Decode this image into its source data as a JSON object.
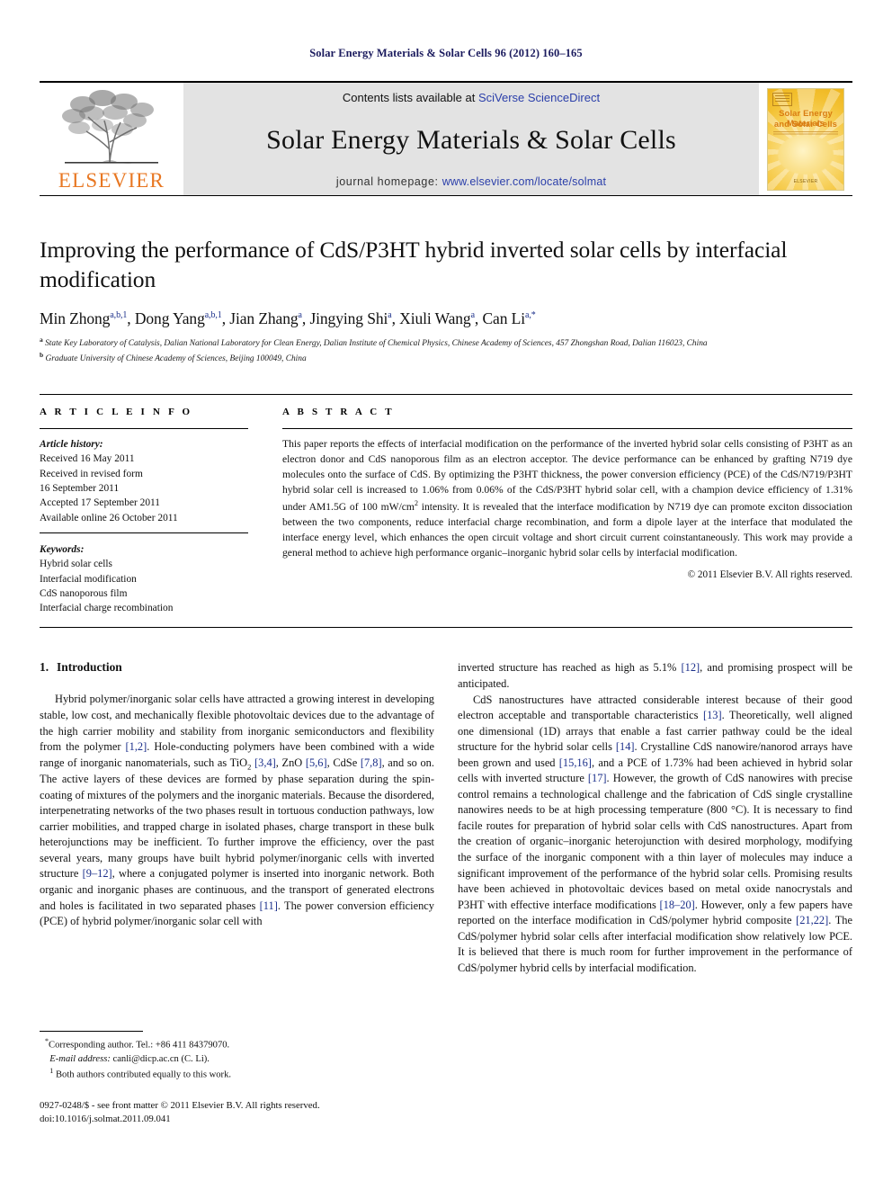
{
  "running_head": "Solar Energy Materials & Solar Cells 96 (2012) 160–165",
  "masthead": {
    "contents_prefix": "Contents lists available at ",
    "contents_link": "SciVerse ScienceDirect",
    "journal_title": "Solar Energy Materials & Solar Cells",
    "homepage_prefix": "journal homepage: ",
    "homepage_link": "www.elsevier.com/locate/solmat",
    "publisher_logo_text": "ELSEVIER",
    "publisher_logo_icon": "elsevier-tree-icon",
    "cover": {
      "title_line1": "Solar Energy Materials",
      "title_line2": "and Solar Cells",
      "footer_text": "ELSEVIER",
      "accent_color": "#E8A31B"
    },
    "link_color": "#2b3faa"
  },
  "article": {
    "title": "Improving the performance of CdS/P3HT hybrid inverted solar cells by interfacial modification",
    "authors": [
      {
        "name": "Min Zhong",
        "sup": "a,b,1",
        "sep": ", "
      },
      {
        "name": "Dong Yang",
        "sup": "a,b,1",
        "sep": ", "
      },
      {
        "name": "Jian Zhang",
        "sup": "a",
        "sep": ", "
      },
      {
        "name": "Jingying Shi",
        "sup": "a",
        "sep": ", "
      },
      {
        "name": "Xiuli Wang",
        "sup": "a",
        "sep": ", "
      },
      {
        "name": "Can Li",
        "sup": "a,*",
        "sep": ""
      }
    ],
    "affiliations": [
      {
        "marker": "a",
        "text": "State Key Laboratory of Catalysis, Dalian National Laboratory for Clean Energy, Dalian Institute of Chemical Physics, Chinese Academy of Sciences, 457 Zhongshan Road, Dalian 116023, China"
      },
      {
        "marker": "b",
        "text": "Graduate University of Chinese Academy of Sciences, Beijing 100049, China"
      }
    ]
  },
  "article_info": {
    "heading": "A R T I C L E   I N F O",
    "history_label": "Article history:",
    "history": [
      "Received 16 May 2011",
      "Received in revised form",
      "16 September 2011",
      "Accepted 17 September 2011",
      "Available online 26 October 2011"
    ],
    "keywords_label": "Keywords:",
    "keywords": [
      "Hybrid solar cells",
      "Interfacial modification",
      "CdS nanoporous film",
      "Interfacial charge recombination"
    ]
  },
  "abstract": {
    "heading": "A B S T R A C T",
    "text_part1": "This paper reports the effects of interfacial modification on the performance of the inverted hybrid solar cells consisting of P3HT as an electron donor and CdS nanoporous film as an electron acceptor. The device performance can be enhanced by grafting N719 dye molecules onto the surface of CdS. By optimizing the P3HT thickness, the power conversion efficiency (PCE) of the CdS/N719/P3HT hybrid solar cell is increased to 1.06% from 0.06% of the CdS/P3HT hybrid solar cell, with a champion device efficiency of 1.31% under AM1.5G of 100 mW/cm",
    "superscript": "2",
    "text_part2": " intensity. It is revealed that the interface modification by N719 dye can promote exciton dissociation between the two components, reduce interfacial charge recombination, and form a dipole layer at the interface that modulated the interface energy level, which enhances the open circuit voltage and short circuit current coinstantaneously. This work may provide a general method to achieve high performance organic–inorganic hybrid solar cells by interfacial modification.",
    "copyright": "© 2011 Elsevier B.V. All rights reserved."
  },
  "body": {
    "section_number": "1.",
    "section_title": "Introduction",
    "left_paragraph_1_a": "Hybrid polymer/inorganic solar cells have attracted a growing interest in developing stable, low cost, and mechanically flexible photovoltaic devices due to the advantage of the high carrier mobility and stability from inorganic semiconductors and flexibility from the polymer ",
    "ref_1_2": "[1,2]",
    "left_paragraph_1_b": ". Hole-conducting polymers have been combined with a wide range of inorganic nanomaterials, such as TiO",
    "sub_2": "2",
    "left_paragraph_1_c": " ",
    "ref_3_4": "[3,4]",
    "left_paragraph_1_d": ", ZnO ",
    "ref_5_6": "[5,6]",
    "left_paragraph_1_e": ", CdSe ",
    "ref_7_8": "[7,8]",
    "left_paragraph_1_f": ", and so on. The active layers of these devices are formed by phase separation during the spin-coating of mixtures of the polymers and the inorganic materials. Because the disordered, interpenetrating networks of the two phases result in tortuous conduction pathways, low carrier mobilities, and trapped charge in isolated phases, charge transport in these bulk heterojunctions may be inefficient. To further improve the efficiency, over the past several years, many groups have built hybrid polymer/inorganic cells with inverted structure ",
    "ref_9_12": "[9–12]",
    "left_paragraph_1_g": ", where a conjugated polymer is inserted into inorganic network. Both organic and inorganic phases are continuous, and the transport of generated electrons and holes is facilitated in two separated phases ",
    "ref_11": "[11]",
    "left_paragraph_1_h": ". The power conversion efficiency (PCE) of hybrid polymer/inorganic solar cell with",
    "right_paragraph_1_a": "inverted structure has reached as high as 5.1% ",
    "ref_12": "[12]",
    "right_paragraph_1_b": ", and promising prospect will be anticipated.",
    "right_paragraph_2_a": "CdS nanostructures have attracted considerable interest because of their good electron acceptable and transportable characteristics ",
    "ref_13": "[13]",
    "right_paragraph_2_b": ". Theoretically, well aligned one dimensional (1D) arrays that enable a fast carrier pathway could be the ideal structure for the hybrid solar cells ",
    "ref_14": "[14]",
    "right_paragraph_2_c": ". Crystalline CdS nanowire/nanorod arrays have been grown and used ",
    "ref_15_16": "[15,16]",
    "right_paragraph_2_d": ", and a PCE of 1.73% had been achieved in hybrid solar cells with inverted structure ",
    "ref_17": "[17]",
    "right_paragraph_2_e": ". However, the growth of CdS nanowires with precise control remains a technological challenge and the fabrication of CdS single crystalline nanowires needs to be at high processing temperature (800 °C). It is necessary to find facile routes for preparation of hybrid solar cells with CdS nanostructures. Apart from the creation of organic–inorganic heterojunction with desired morphology, modifying the surface of the inorganic component with a thin layer of molecules may induce a significant improvement of the performance of the hybrid solar cells. Promising results have been achieved in photovoltaic devices based on metal oxide nanocrystals and P3HT with effective interface modifications ",
    "ref_18_20": "[18–20]",
    "right_paragraph_2_f": ". However, only a few papers have reported on the interface modification in CdS/polymer hybrid composite ",
    "ref_21_22": "[21,22]",
    "right_paragraph_2_g": ". The CdS/polymer hybrid solar cells after interfacial modification show relatively low PCE. It is believed that there is much room for further improvement in the performance of CdS/polymer hybrid cells by interfacial modification."
  },
  "footnotes": {
    "corresponding_marker": "*",
    "corresponding": "Corresponding author. Tel.: +86 411 84379070.",
    "email_label": "E-mail address:",
    "email": "canli@dicp.ac.cn (C. Li).",
    "equal_marker": "1",
    "equal_contrib": "Both authors contributed equally to this work."
  },
  "imprint": {
    "line1": "0927-0248/$ - see front matter © 2011 Elsevier B.V. All rights reserved.",
    "line2": "doi:10.1016/j.solmat.2011.09.041"
  }
}
